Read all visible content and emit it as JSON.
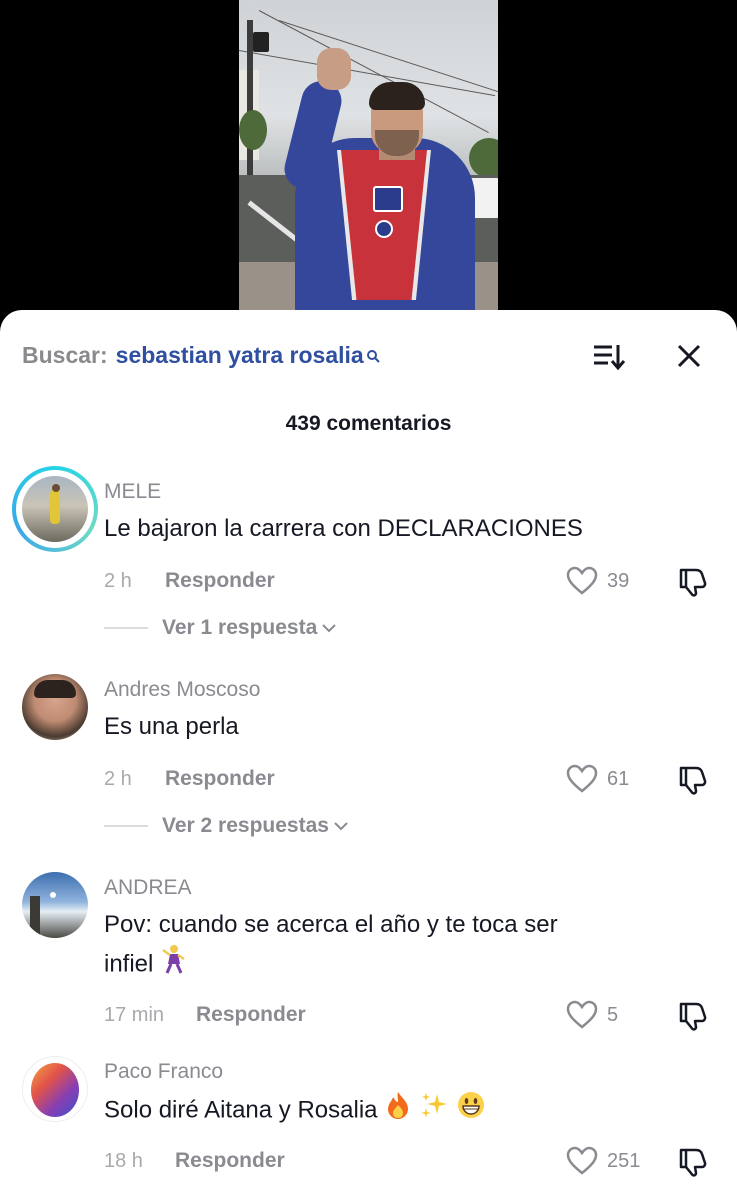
{
  "search": {
    "label": "Buscar:",
    "query": "sebastian yatra rosalia"
  },
  "comments_count": "439 comentarios",
  "reply_label": "Responder",
  "comments": [
    {
      "username": "MELE",
      "text": "Le bajaron la carrera con DECLARACIONES",
      "time": "2 h",
      "likes": "39",
      "replies_label": "Ver 1 respuesta",
      "has_story_ring": true
    },
    {
      "username": "Andres Moscoso",
      "text": "Es una perla",
      "time": "2 h",
      "likes": "61",
      "replies_label": "Ver 2 respuestas"
    },
    {
      "username": "ANDREA",
      "text_line1": "Pov: cuando se acerca el año y te toca ser",
      "text_line2": "infiel",
      "time": "17 min",
      "likes": "5"
    },
    {
      "username": "Paco Franco",
      "text": "Solo diré Aitana y Rosalia",
      "time": "18 h",
      "likes": "251"
    }
  ],
  "colors": {
    "query": "#2f4fa0",
    "muted": "#8a8b91",
    "text": "#161823",
    "ring": "#24d4e6"
  }
}
